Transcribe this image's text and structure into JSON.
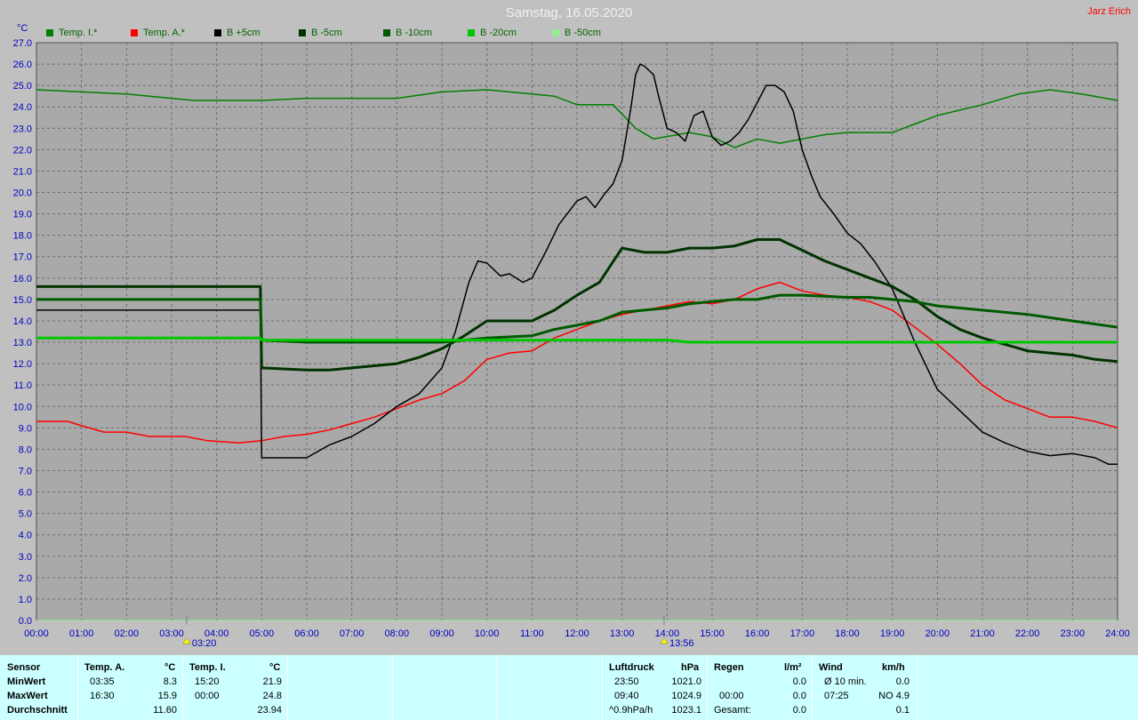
{
  "header": {
    "title": "Samstag, 16.05.2020",
    "author": "Jarz Erich",
    "unit": "°C"
  },
  "legend": [
    {
      "label": "Temp. I.*",
      "color": "#008000"
    },
    {
      "label": "Temp. A.*",
      "color": "#ff0000"
    },
    {
      "label": "B +5cm",
      "color": "#000000"
    },
    {
      "label": "B -5cm",
      "color": "#003300"
    },
    {
      "label": "B -10cm",
      "color": "#005a00"
    },
    {
      "label": "B -20cm",
      "color": "#00c800"
    },
    {
      "label": "B -50cm",
      "color": "#90ee90"
    }
  ],
  "markers": {
    "sunrise": "03:20",
    "sunset": "13:56"
  },
  "chart_data": {
    "type": "line",
    "title": "Samstag, 16.05.2020",
    "ylabel": "°C",
    "ylim": [
      0,
      27
    ],
    "xlim": [
      0,
      24
    ],
    "grid": true,
    "x_ticks": [
      "00:00",
      "01:00",
      "02:00",
      "03:00",
      "04:00",
      "05:00",
      "06:00",
      "07:00",
      "08:00",
      "09:00",
      "10:00",
      "11:00",
      "12:00",
      "13:00",
      "14:00",
      "15:00",
      "16:00",
      "17:00",
      "18:00",
      "19:00",
      "20:00",
      "21:00",
      "22:00",
      "23:00",
      "24:00"
    ],
    "y_ticks": [
      "0.0",
      "1.0",
      "2.0",
      "3.0",
      "4.0",
      "5.0",
      "6.0",
      "7.0",
      "8.0",
      "9.0",
      "10.0",
      "11.0",
      "12.0",
      "13.0",
      "14.0",
      "15.0",
      "16.0",
      "17.0",
      "18.0",
      "19.0",
      "20.0",
      "21.0",
      "22.0",
      "23.0",
      "24.0",
      "25.0",
      "26.0",
      "27.0"
    ],
    "series": [
      {
        "name": "Temp. I.*",
        "color": "#008000",
        "width": 1.5,
        "points": [
          [
            0,
            24.8
          ],
          [
            1,
            24.7
          ],
          [
            2,
            24.6
          ],
          [
            3,
            24.4
          ],
          [
            3.5,
            24.3
          ],
          [
            5,
            24.3
          ],
          [
            6,
            24.4
          ],
          [
            7,
            24.4
          ],
          [
            8,
            24.4
          ],
          [
            9,
            24.7
          ],
          [
            10,
            24.8
          ],
          [
            11,
            24.6
          ],
          [
            11.5,
            24.5
          ],
          [
            12,
            24.1
          ],
          [
            12.8,
            24.1
          ],
          [
            13.3,
            23.0
          ],
          [
            13.7,
            22.5
          ],
          [
            14.5,
            22.8
          ],
          [
            15,
            22.6
          ],
          [
            15.5,
            22.1
          ],
          [
            16,
            22.5
          ],
          [
            16.5,
            22.3
          ],
          [
            17,
            22.5
          ],
          [
            17.5,
            22.7
          ],
          [
            18,
            22.8
          ],
          [
            19,
            22.8
          ],
          [
            19.5,
            23.2
          ],
          [
            20,
            23.6
          ],
          [
            21,
            24.1
          ],
          [
            21.8,
            24.6
          ],
          [
            22.5,
            24.8
          ],
          [
            23.2,
            24.6
          ],
          [
            24,
            24.3
          ]
        ]
      },
      {
        "name": "Temp. A.*",
        "color": "#ff0000",
        "width": 1.5,
        "points": [
          [
            0,
            9.3
          ],
          [
            0.7,
            9.3
          ],
          [
            1,
            9.1
          ],
          [
            1.5,
            8.8
          ],
          [
            2,
            8.8
          ],
          [
            2.5,
            8.6
          ],
          [
            3.3,
            8.6
          ],
          [
            3.8,
            8.4
          ],
          [
            4.5,
            8.3
          ],
          [
            5,
            8.4
          ],
          [
            5.5,
            8.6
          ],
          [
            6,
            8.7
          ],
          [
            6.5,
            8.9
          ],
          [
            7,
            9.2
          ],
          [
            7.5,
            9.5
          ],
          [
            8,
            9.9
          ],
          [
            8.5,
            10.3
          ],
          [
            9,
            10.6
          ],
          [
            9.5,
            11.2
          ],
          [
            10,
            12.2
          ],
          [
            10.5,
            12.5
          ],
          [
            11,
            12.6
          ],
          [
            11.5,
            13.2
          ],
          [
            12,
            13.6
          ],
          [
            12.5,
            14.0
          ],
          [
            13,
            14.3
          ],
          [
            13.5,
            14.5
          ],
          [
            14,
            14.7
          ],
          [
            14.5,
            14.9
          ],
          [
            15,
            14.8
          ],
          [
            15.5,
            15.0
          ],
          [
            16,
            15.5
          ],
          [
            16.5,
            15.8
          ],
          [
            17,
            15.4
          ],
          [
            17.5,
            15.2
          ],
          [
            18,
            15.1
          ],
          [
            18.5,
            14.9
          ],
          [
            19,
            14.5
          ],
          [
            19.5,
            13.7
          ],
          [
            20,
            12.9
          ],
          [
            20.5,
            12.0
          ],
          [
            21,
            11.0
          ],
          [
            21.5,
            10.3
          ],
          [
            22,
            9.9
          ],
          [
            22.5,
            9.5
          ],
          [
            23,
            9.5
          ],
          [
            23.5,
            9.3
          ],
          [
            24,
            9.0
          ]
        ]
      },
      {
        "name": "B +5cm",
        "color": "#000000",
        "width": 1.5,
        "points": [
          [
            0,
            14.5
          ],
          [
            4.97,
            14.5
          ],
          [
            5.0,
            7.6
          ],
          [
            6,
            7.6
          ],
          [
            6.5,
            8.2
          ],
          [
            7,
            8.6
          ],
          [
            7.5,
            9.2
          ],
          [
            8,
            10.0
          ],
          [
            8.5,
            10.6
          ],
          [
            9,
            11.8
          ],
          [
            9.3,
            13.5
          ],
          [
            9.6,
            15.8
          ],
          [
            9.8,
            16.8
          ],
          [
            10,
            16.7
          ],
          [
            10.3,
            16.1
          ],
          [
            10.5,
            16.2
          ],
          [
            10.8,
            15.8
          ],
          [
            11,
            16.0
          ],
          [
            11.3,
            17.2
          ],
          [
            11.6,
            18.5
          ],
          [
            12,
            19.6
          ],
          [
            12.2,
            19.8
          ],
          [
            12.4,
            19.3
          ],
          [
            12.6,
            19.9
          ],
          [
            12.8,
            20.4
          ],
          [
            13,
            21.5
          ],
          [
            13.2,
            24.0
          ],
          [
            13.3,
            25.5
          ],
          [
            13.4,
            26.0
          ],
          [
            13.5,
            25.9
          ],
          [
            13.7,
            25.5
          ],
          [
            13.8,
            24.6
          ],
          [
            14,
            23.0
          ],
          [
            14.2,
            22.8
          ],
          [
            14.4,
            22.4
          ],
          [
            14.6,
            23.6
          ],
          [
            14.8,
            23.8
          ],
          [
            15,
            22.6
          ],
          [
            15.2,
            22.2
          ],
          [
            15.4,
            22.4
          ],
          [
            15.6,
            22.8
          ],
          [
            15.8,
            23.4
          ],
          [
            16,
            24.2
          ],
          [
            16.2,
            25.0
          ],
          [
            16.4,
            25.0
          ],
          [
            16.6,
            24.7
          ],
          [
            16.8,
            23.8
          ],
          [
            17,
            22.0
          ],
          [
            17.2,
            20.8
          ],
          [
            17.4,
            19.8
          ],
          [
            17.7,
            19.0
          ],
          [
            18,
            18.1
          ],
          [
            18.3,
            17.6
          ],
          [
            18.6,
            16.8
          ],
          [
            19,
            15.5
          ],
          [
            19.5,
            13.0
          ],
          [
            20,
            10.8
          ],
          [
            20.5,
            9.8
          ],
          [
            21,
            8.8
          ],
          [
            21.5,
            8.3
          ],
          [
            22,
            7.9
          ],
          [
            22.5,
            7.7
          ],
          [
            23,
            7.8
          ],
          [
            23.5,
            7.6
          ],
          [
            23.8,
            7.3
          ],
          [
            24,
            7.3
          ]
        ]
      },
      {
        "name": "B -5cm",
        "color": "#003300",
        "width": 3,
        "points": [
          [
            0,
            15.6
          ],
          [
            4.97,
            15.6
          ],
          [
            5.0,
            11.8
          ],
          [
            6,
            11.7
          ],
          [
            6.5,
            11.7
          ],
          [
            7,
            11.8
          ],
          [
            8,
            12.0
          ],
          [
            8.5,
            12.3
          ],
          [
            9,
            12.7
          ],
          [
            9.5,
            13.3
          ],
          [
            10,
            14.0
          ],
          [
            10.5,
            14.0
          ],
          [
            11,
            14.0
          ],
          [
            11.5,
            14.5
          ],
          [
            12,
            15.2
          ],
          [
            12.5,
            15.8
          ],
          [
            13,
            17.4
          ],
          [
            13.5,
            17.2
          ],
          [
            14,
            17.2
          ],
          [
            14.5,
            17.4
          ],
          [
            15,
            17.4
          ],
          [
            15.5,
            17.5
          ],
          [
            16,
            17.8
          ],
          [
            16.5,
            17.8
          ],
          [
            17,
            17.3
          ],
          [
            17.5,
            16.8
          ],
          [
            18,
            16.4
          ],
          [
            18.5,
            16.0
          ],
          [
            19,
            15.6
          ],
          [
            19.5,
            15.0
          ],
          [
            20,
            14.2
          ],
          [
            20.5,
            13.6
          ],
          [
            21,
            13.2
          ],
          [
            21.5,
            12.9
          ],
          [
            22,
            12.6
          ],
          [
            22.5,
            12.5
          ],
          [
            23,
            12.4
          ],
          [
            23.5,
            12.2
          ],
          [
            24,
            12.1
          ]
        ]
      },
      {
        "name": "B -10cm",
        "color": "#005a00",
        "width": 3,
        "points": [
          [
            0,
            15.0
          ],
          [
            4.97,
            15.0
          ],
          [
            5.0,
            13.1
          ],
          [
            6,
            13.0
          ],
          [
            7,
            13.0
          ],
          [
            8,
            13.0
          ],
          [
            9,
            13.0
          ],
          [
            9.5,
            13.1
          ],
          [
            10,
            13.2
          ],
          [
            11,
            13.3
          ],
          [
            11.5,
            13.6
          ],
          [
            12,
            13.8
          ],
          [
            12.5,
            14.0
          ],
          [
            13,
            14.4
          ],
          [
            14,
            14.6
          ],
          [
            14.5,
            14.8
          ],
          [
            15,
            14.9
          ],
          [
            15.5,
            15.0
          ],
          [
            16,
            15.0
          ],
          [
            16.5,
            15.2
          ],
          [
            17,
            15.2
          ],
          [
            18,
            15.1
          ],
          [
            18.5,
            15.1
          ],
          [
            19,
            15.0
          ],
          [
            19.5,
            14.9
          ],
          [
            20,
            14.7
          ],
          [
            21,
            14.5
          ],
          [
            22,
            14.3
          ],
          [
            23,
            14.0
          ],
          [
            24,
            13.7
          ]
        ]
      },
      {
        "name": "B -20cm",
        "color": "#00c800",
        "width": 3,
        "points": [
          [
            0,
            13.2
          ],
          [
            4.97,
            13.2
          ],
          [
            5.0,
            13.1
          ],
          [
            6,
            13.1
          ],
          [
            7,
            13.1
          ],
          [
            8,
            13.1
          ],
          [
            9,
            13.1
          ],
          [
            10,
            13.1
          ],
          [
            11,
            13.1
          ],
          [
            12,
            13.1
          ],
          [
            13,
            13.1
          ],
          [
            14,
            13.1
          ],
          [
            14.5,
            13.0
          ],
          [
            15,
            13.0
          ],
          [
            16,
            13.0
          ],
          [
            17,
            13.0
          ],
          [
            18,
            13.0
          ],
          [
            19,
            13.0
          ],
          [
            20,
            13.0
          ],
          [
            21,
            13.0
          ],
          [
            22,
            13.0
          ],
          [
            23,
            13.0
          ],
          [
            24,
            13.0
          ]
        ]
      },
      {
        "name": "B -50cm",
        "color": "#90ee90",
        "width": 1,
        "points": [
          [
            0,
            0.0
          ],
          [
            24,
            0.0
          ]
        ]
      }
    ]
  },
  "table": {
    "sensor": {
      "title": "Sensor",
      "rows": [
        "MinWert",
        "MaxWert",
        "Durchschnitt"
      ]
    },
    "temp_a": {
      "title": "Temp. A.",
      "unit": "°C",
      "min_time": "03:35",
      "min_val": "8.3",
      "max_time": "16:30",
      "max_val": "15.9",
      "avg": "11.60"
    },
    "temp_i": {
      "title": "Temp. I.",
      "unit": "°C",
      "min_time": "15:20",
      "min_val": "21.9",
      "max_time": "00:00",
      "max_val": "24.8",
      "avg": "23.94"
    },
    "pressure": {
      "title": "Luftdruck",
      "unit": "hPa",
      "min_time": "23:50",
      "min_val": "1021.0",
      "max_time": "09:40",
      "max_val": "1024.9",
      "trend": "^0.9hPa/h",
      "current": "1023.1"
    },
    "rain": {
      "title": "Regen",
      "unit": "l/m²",
      "time": "00:00",
      "val1": "0.0",
      "val2": "0.0",
      "total_label": "Gesamt:",
      "total": "0.0"
    },
    "wind": {
      "title": "Wind",
      "unit": "km/h",
      "avg_label": "Ø 10 min.",
      "avg": "0.0",
      "max_time": "07:25",
      "max_val": "NO 4.9",
      "mean": "0.1"
    }
  }
}
